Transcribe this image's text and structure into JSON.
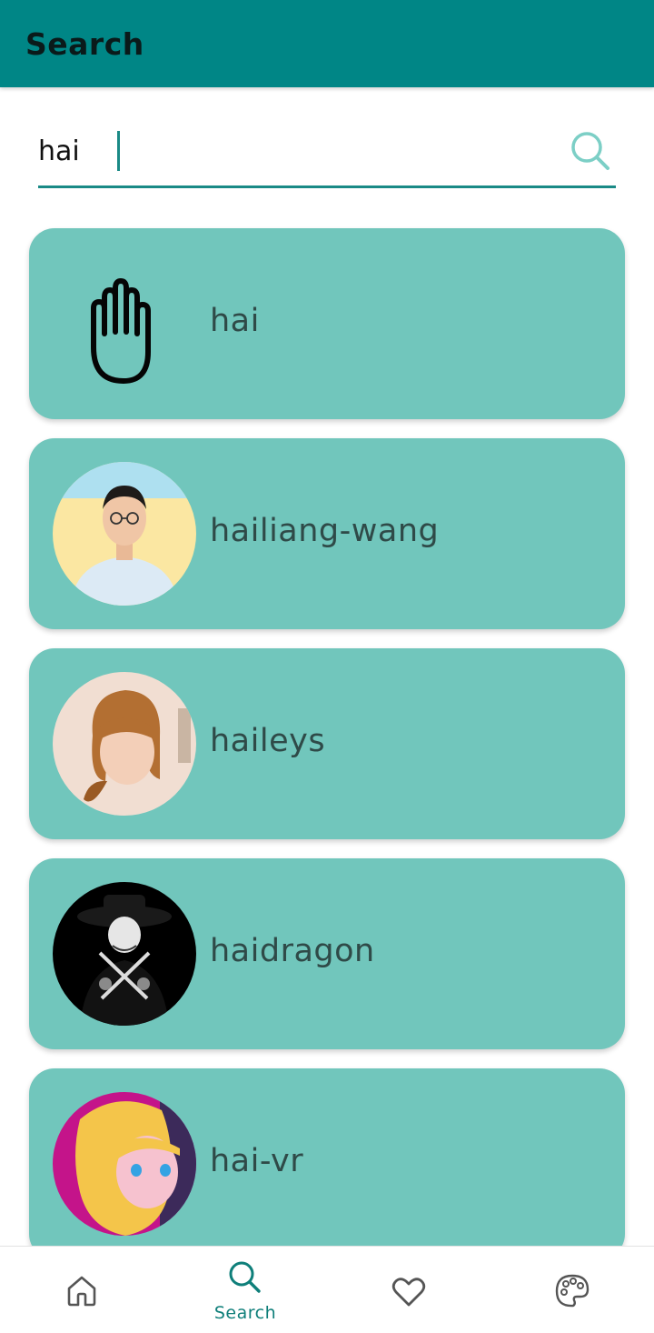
{
  "appbar": {
    "title": "Search"
  },
  "search": {
    "value": "hai"
  },
  "results": [
    {
      "label": "hai",
      "avatar": "raised-hand-icon"
    },
    {
      "label": "hailiang-wang",
      "avatar": "user-photo"
    },
    {
      "label": "haileys",
      "avatar": "user-photo"
    },
    {
      "label": "haidragon",
      "avatar": "user-photo"
    },
    {
      "label": "hai-vr",
      "avatar": "user-photo"
    }
  ],
  "nav": {
    "home_icon": "home-icon",
    "search_label": "Search",
    "favorites_icon": "heart-icon",
    "theme_icon": "palette-icon"
  },
  "colors": {
    "appbar": "#008686",
    "card": "#71c6bc",
    "accent": "#1a8a86"
  }
}
